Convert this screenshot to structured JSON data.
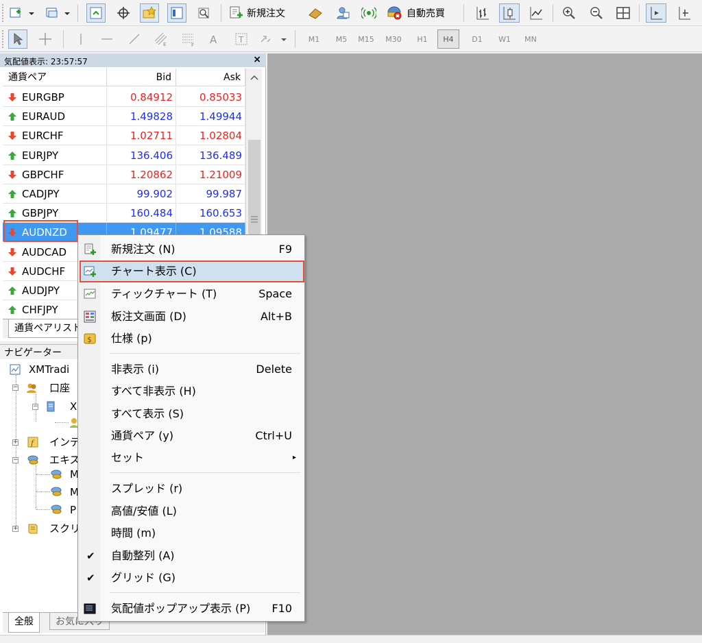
{
  "toolbar": {
    "new_order": "新規注文",
    "auto_trading": "自動売買",
    "timeframes": [
      "M1",
      "M5",
      "M15",
      "M30",
      "H1",
      "H4",
      "D1",
      "W1",
      "MN"
    ],
    "active_timeframe": "H4"
  },
  "market_watch": {
    "title": "気配値表示: 23:57:57",
    "close": "×",
    "columns": {
      "symbol": "通貨ペア",
      "bid": "Bid",
      "ask": "Ask"
    },
    "rows": [
      {
        "symbol": "EURGBP",
        "bid": "0.84912",
        "ask": "0.85033",
        "dir": "down",
        "color": "#f02020"
      },
      {
        "symbol": "EURAUD",
        "bid": "1.49828",
        "ask": "1.49944",
        "dir": "up",
        "color": "#1f2ef5"
      },
      {
        "symbol": "EURCHF",
        "bid": "1.02711",
        "ask": "1.02804",
        "dir": "down",
        "color": "#f02020"
      },
      {
        "symbol": "EURJPY",
        "bid": "136.406",
        "ask": "136.489",
        "dir": "up",
        "color": "#1f2ef5"
      },
      {
        "symbol": "GBPCHF",
        "bid": "1.20862",
        "ask": "1.21009",
        "dir": "down",
        "color": "#f02020"
      },
      {
        "symbol": "CADJPY",
        "bid": "99.902",
        "ask": "99.987",
        "dir": "up",
        "color": "#1f2ef5"
      },
      {
        "symbol": "GBPJPY",
        "bid": "160.484",
        "ask": "160.653",
        "dir": "up",
        "color": "#1f2ef5"
      },
      {
        "symbol": "AUDNZD",
        "bid": "1.09477",
        "ask": "1.09588",
        "dir": "down",
        "selected": true
      },
      {
        "symbol": "AUDCAD",
        "bid": "",
        "ask": "",
        "dir": "down"
      },
      {
        "symbol": "AUDCHF",
        "bid": "",
        "ask": "",
        "dir": "down"
      },
      {
        "symbol": "AUDJPY",
        "bid": "",
        "ask": "",
        "dir": "up"
      },
      {
        "symbol": "CHFJPY",
        "bid": "",
        "ask": "",
        "dir": "up"
      }
    ],
    "tabs": [
      "通貨ペアリスト"
    ]
  },
  "navigator": {
    "title": "ナビゲーター",
    "items": {
      "root": "XMTradi",
      "accounts": "口座",
      "account_x": "X",
      "indicators": "インデ",
      "experts": "エキス",
      "expert_m1": "M",
      "expert_m2": "M",
      "expert_p": "P",
      "scripts": "スクリプ"
    },
    "tabs": {
      "general": "全般",
      "favorites": "お気に入り"
    }
  },
  "context_menu": {
    "items": [
      {
        "label": "新規注文 (N)",
        "shortcut": "F9",
        "icon": "new-order-icon"
      },
      {
        "label": "チャート表示 (C)",
        "shortcut": "",
        "icon": "chart-window-icon",
        "highlighted": true
      },
      {
        "label": "ティックチャート (T)",
        "shortcut": "Space",
        "icon": "tick-chart-icon"
      },
      {
        "label": "板注文画面 (D)",
        "shortcut": "Alt+B",
        "icon": "depth-of-market-icon"
      },
      {
        "label": "仕様 (p)",
        "shortcut": "",
        "icon": "specification-icon"
      },
      {
        "label": "非表示 (i)",
        "shortcut": "Delete"
      },
      {
        "label": "すべて非表示 (H)",
        "shortcut": ""
      },
      {
        "label": "すべて表示 (S)",
        "shortcut": ""
      },
      {
        "label": "通貨ペア (y)",
        "shortcut": "Ctrl+U"
      },
      {
        "label": "セット",
        "shortcut": "",
        "submenu": "▸"
      },
      {
        "label": "スプレッド (r)",
        "shortcut": ""
      },
      {
        "label": "高値/安値 (L)",
        "shortcut": ""
      },
      {
        "label": "時間 (m)",
        "shortcut": ""
      },
      {
        "label": "自動整列 (A)",
        "shortcut": "",
        "checked": "✔"
      },
      {
        "label": "グリッド (G)",
        "shortcut": "",
        "checked": "✔"
      },
      {
        "label": "気配値ポップアップ表示 (P)",
        "shortcut": "F10",
        "icon": "popup-prices-icon"
      }
    ]
  }
}
